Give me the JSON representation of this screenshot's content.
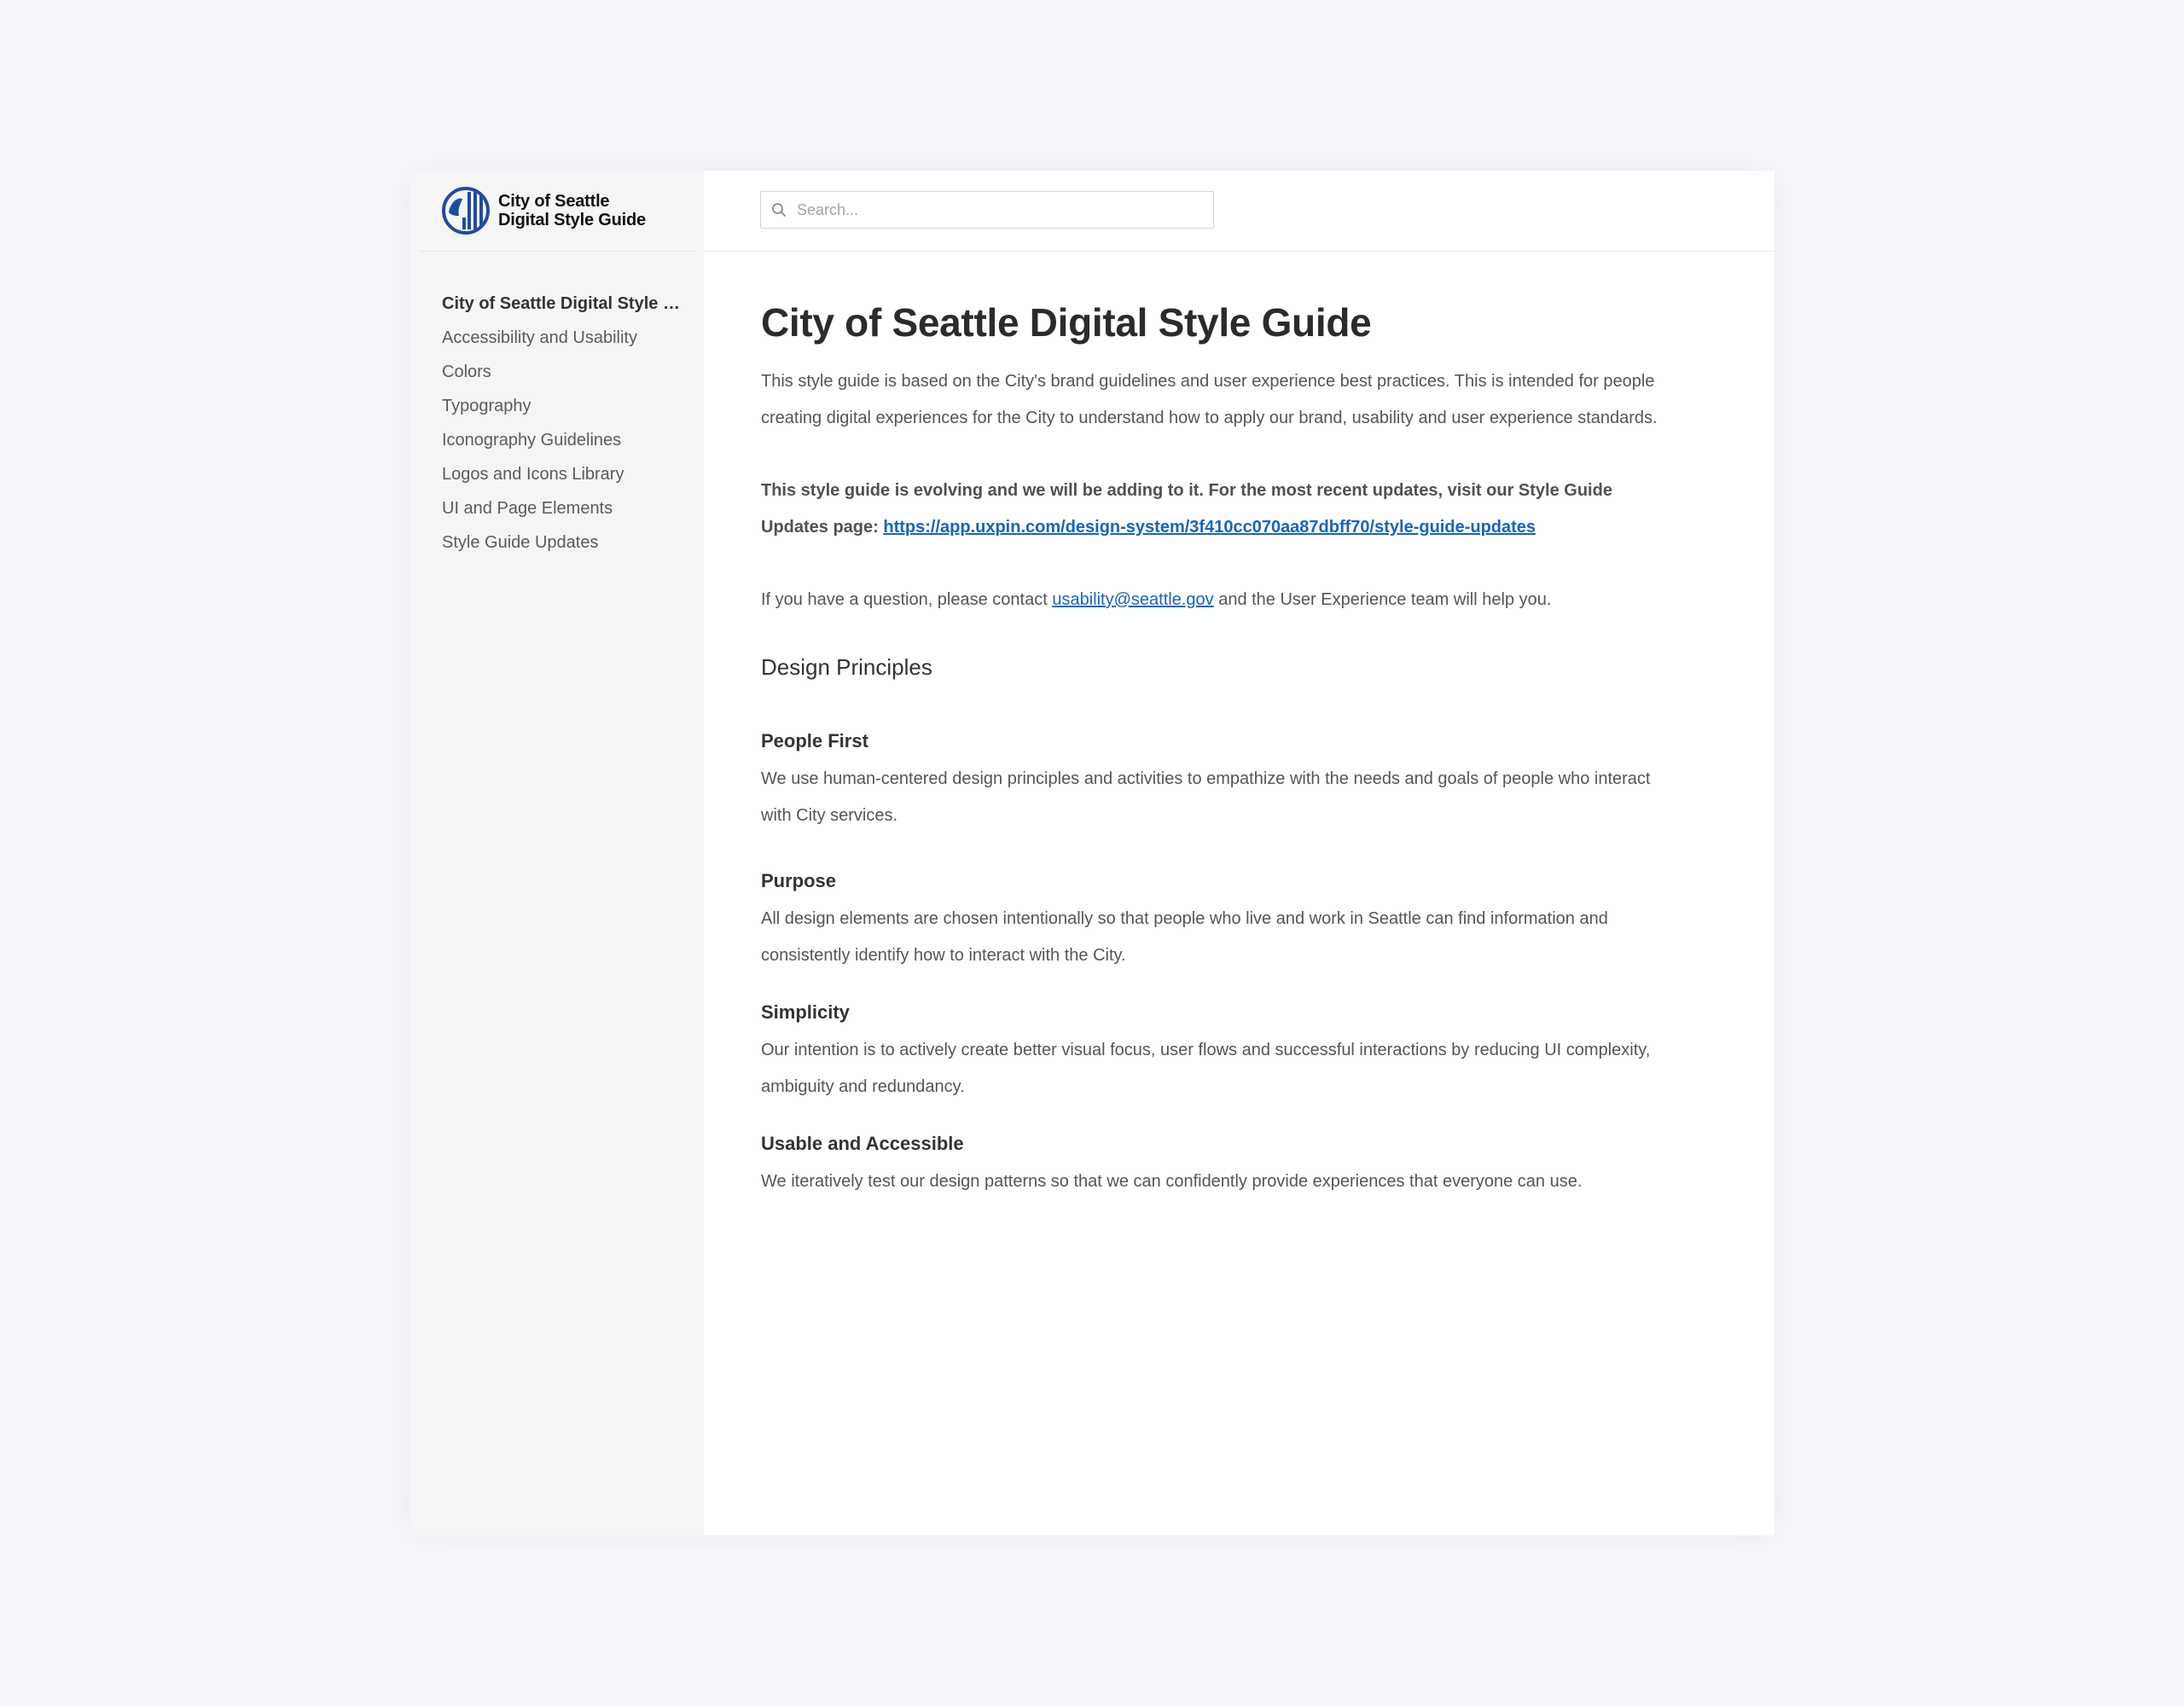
{
  "sidebar": {
    "brand": {
      "line1": "City of Seattle",
      "line2": "Digital Style Guide",
      "logo_icon": "seattle-seal-logo",
      "logo_color": "#1d4da0"
    },
    "items": [
      {
        "label": "City of Seattle Digital Style Guide",
        "active": true
      },
      {
        "label": "Accessibility and Usability"
      },
      {
        "label": "Colors"
      },
      {
        "label": "Typography"
      },
      {
        "label": "Iconography Guidelines"
      },
      {
        "label": "Logos and Icons Library"
      },
      {
        "label": "UI and Page Elements"
      },
      {
        "label": "Style Guide Updates"
      }
    ]
  },
  "search": {
    "placeholder": "Search...",
    "icon": "search-icon"
  },
  "page": {
    "title": "City of Seattle Digital Style Guide",
    "intro": "This style guide is based on the City's brand guidelines and user experience best practices. This is intended for people creating digital experiences for the City to understand how to apply our brand, usability and user experience standards.",
    "updates_text": "This style guide is evolving and we will be adding to it. For the most recent updates, visit our Style Guide Updates page: ",
    "updates_link": "https://app.uxpin.com/design-system/3f410cc070aa87dbff70/style-guide-updates",
    "contact_prefix": "If you have a question, please contact ",
    "contact_email": "usability@seattle.gov",
    "contact_suffix": " and the User Experience team will help you.",
    "principles_heading": "Design Principles",
    "principles": [
      {
        "title": "People First",
        "text": "We use human-centered design principles and activities to empathize with the needs and goals of people who interact with City services."
      },
      {
        "title": "Purpose",
        "text": "All design elements are chosen intentionally so that people who live and work in Seattle can find information and consistently identify how to interact with the City."
      },
      {
        "title": "Simplicity",
        "text": "Our intention is to actively create better visual focus, user flows and successful interactions by reducing UI complexity, ambiguity and redundancy."
      },
      {
        "title": "Usable and Accessible",
        "text": "We iteratively test our design patterns so that we can confidently provide experiences that everyone can use."
      }
    ]
  },
  "colors": {
    "background": "#f6f7fa",
    "sidebar": "#f5f5f5",
    "link": "#1565c0"
  }
}
